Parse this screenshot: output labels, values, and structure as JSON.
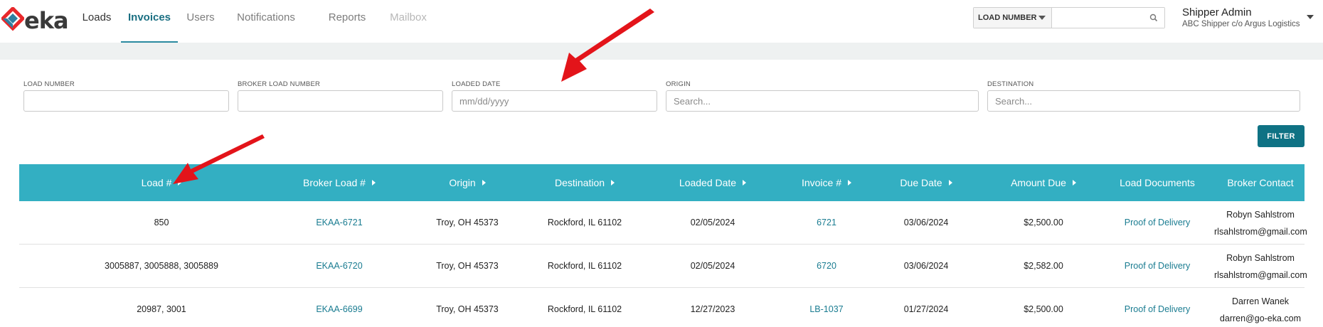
{
  "header": {
    "logo_text": "eka",
    "nav": [
      {
        "label": "Loads"
      },
      {
        "label": "Invoices"
      },
      {
        "label": "Users"
      },
      {
        "label": "Notifications"
      },
      {
        "label": "Reports"
      },
      {
        "label": "Mailbox"
      }
    ],
    "search": {
      "select_value": "LOAD NUMBER",
      "input_value": "",
      "icon": "search-icon"
    },
    "user": {
      "name": "Shipper Admin",
      "company": "ABC Shipper c/o Argus Logistics"
    }
  },
  "filters": {
    "load_number": {
      "label": "LOAD NUMBER",
      "value": "",
      "placeholder": ""
    },
    "broker_load_number": {
      "label": "BROKER LOAD NUMBER",
      "value": "",
      "placeholder": ""
    },
    "loaded_date": {
      "label": "LOADED DATE",
      "value": "",
      "placeholder": "mm/dd/yyyy"
    },
    "origin": {
      "label": "ORIGIN",
      "value": "",
      "placeholder": "Search..."
    },
    "destination": {
      "label": "DESTINATION",
      "value": "",
      "placeholder": "Search..."
    },
    "filter_button": "FILTER"
  },
  "table": {
    "columns": [
      {
        "label": "Load #"
      },
      {
        "label": "Broker Load #"
      },
      {
        "label": "Origin"
      },
      {
        "label": "Destination"
      },
      {
        "label": "Loaded Date"
      },
      {
        "label": "Invoice #"
      },
      {
        "label": "Due Date"
      },
      {
        "label": "Amount Due"
      },
      {
        "label": "Load Documents"
      },
      {
        "label": "Broker Contact"
      }
    ],
    "rows": [
      {
        "load": "850",
        "broker_load": "EKAA-6721",
        "origin": "Troy, OH 45373",
        "destination": "Rockford, IL 61102",
        "loaded_date": "02/05/2024",
        "invoice": "6721",
        "due_date": "03/06/2024",
        "amount": "$2,500.00",
        "documents": "Proof of Delivery",
        "contact_name": "Robyn Sahlstrom",
        "contact_email": "rlsahlstrom@gmail.com"
      },
      {
        "load": "3005887, 3005888, 3005889",
        "broker_load": "EKAA-6720",
        "origin": "Troy, OH 45373",
        "destination": "Rockford, IL 61102",
        "loaded_date": "02/05/2024",
        "invoice": "6720",
        "due_date": "03/06/2024",
        "amount": "$2,582.00",
        "documents": "Proof of Delivery",
        "contact_name": "Robyn Sahlstrom",
        "contact_email": "rlsahlstrom@gmail.com"
      },
      {
        "load": "20987, 3001",
        "broker_load": "EKAA-6699",
        "origin": "Troy, OH 45373",
        "destination": "Rockford, IL 61102",
        "loaded_date": "12/27/2023",
        "invoice": "LB-1037",
        "due_date": "01/27/2024",
        "amount": "$2,500.00",
        "documents": "Proof of Delivery",
        "contact_name": "Darren Wanek",
        "contact_email": "darren@go-eka.com"
      }
    ]
  },
  "colors": {
    "accent": "#33afc2",
    "button": "#0f7284",
    "link": "#1a7c91",
    "annotation_arrow": "#e3141a"
  }
}
